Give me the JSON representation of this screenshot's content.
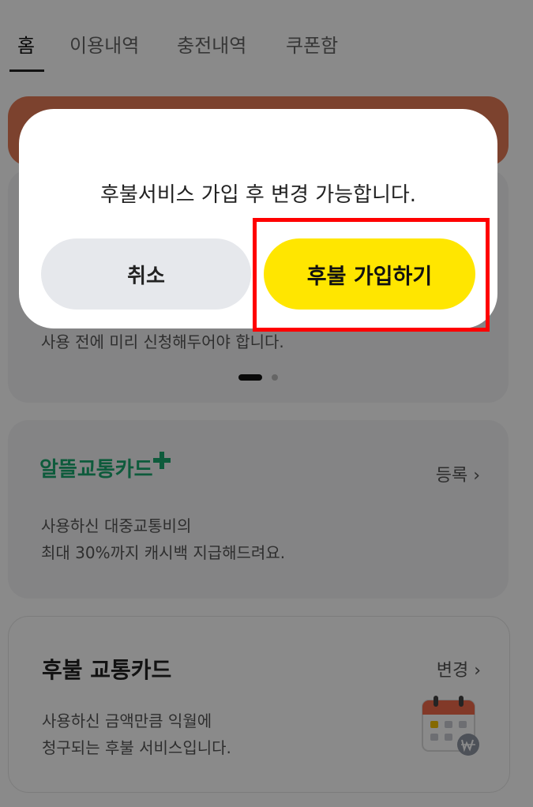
{
  "tabs": [
    {
      "label": "홈",
      "active": true
    },
    {
      "label": "이용내역"
    },
    {
      "label": "충전내역"
    },
    {
      "label": "쿠폰함"
    }
  ],
  "card1": {
    "desc": "사용 전에 미리 신청해두어야 합니다."
  },
  "card2": {
    "logo_text": "알뜰교통카드",
    "link_label": "등록 ›",
    "desc_lines": [
      "사용하신 대중교통비의",
      "최대 30%까지 캐시백 지급해드려요."
    ]
  },
  "card3": {
    "title": "후불 교통카드",
    "link_label": "변경 ›",
    "desc_lines": [
      "사용하신 금액만큼 익월에",
      "청구되는 후불 서비스입니다."
    ]
  },
  "modal": {
    "message": "후불서비스 가입 후 변경 가능합니다.",
    "cancel_label": "취소",
    "confirm_label": "후불 가입하기"
  },
  "colors": {
    "accent_yellow": "#ffe600",
    "highlight_red": "#ff0000",
    "brand_green": "#1aa970"
  }
}
